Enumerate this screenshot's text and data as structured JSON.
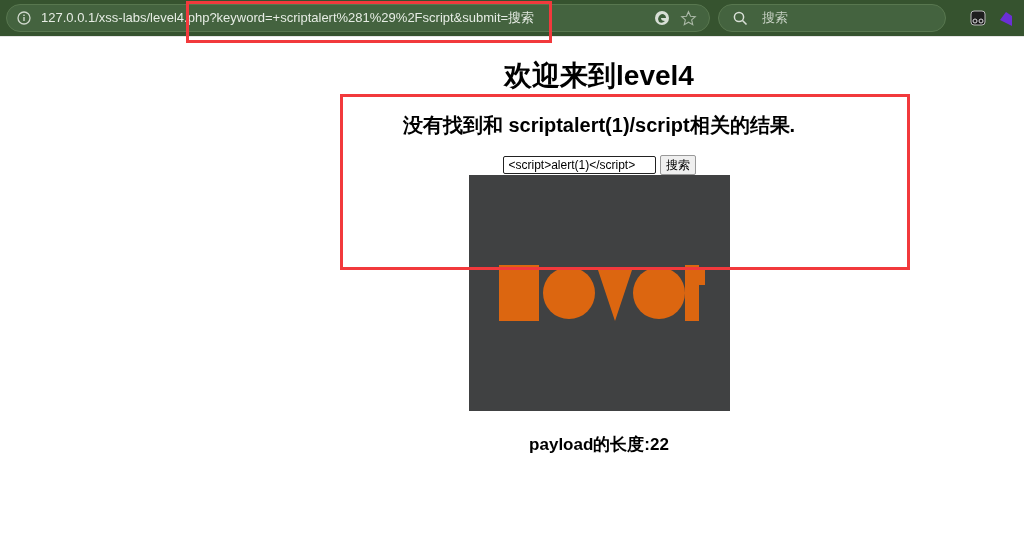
{
  "browser": {
    "url": "127.0.0.1/xss-labs/level4.php?keyword=+scriptalert%281%29%2Fscript&submit=搜索",
    "search": {
      "placeholder": "搜索"
    }
  },
  "page": {
    "title": "欢迎来到level4",
    "message": "没有找到和 scriptalert(1)/script相关的结果.",
    "input": {
      "value": "<script>alert(1)</script>"
    },
    "button": "搜索",
    "payload": "payload的长度:22"
  }
}
